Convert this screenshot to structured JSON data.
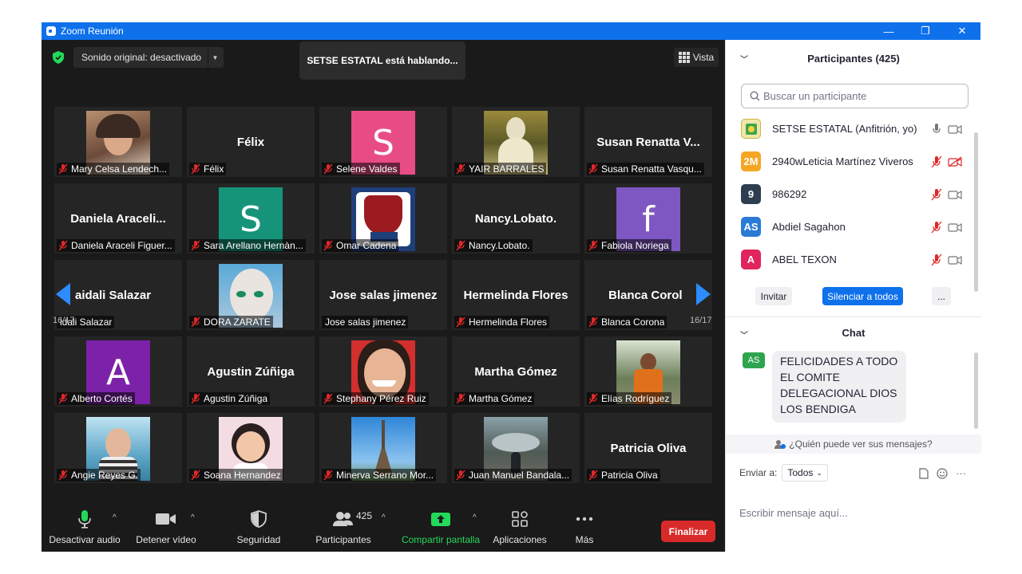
{
  "window": {
    "title": "Zoom Reunión",
    "minimize": "—",
    "restore": "❐",
    "close": "✕"
  },
  "meeting": {
    "audio_dropdown": "Sonido original: desactivado",
    "speaking_banner": "SETSE ESTATAL está hablando...",
    "view_button": "Vista",
    "page_indicator": "16/17"
  },
  "tiles": [
    {
      "name": "Mary Celsa  Lendech...",
      "type": "photo"
    },
    {
      "name": "Félix",
      "big": "Félix",
      "type": "text"
    },
    {
      "name": "Selene Valdes",
      "letter": "S",
      "color": "#e84c85",
      "type": "letter"
    },
    {
      "name": "YAIR BARRALES",
      "type": "photo"
    },
    {
      "name": "Susan Renatta Vasqu...",
      "big": "Susan Renatta V...",
      "type": "text"
    },
    {
      "name": "Daniela Araceli Figuer...",
      "big": "Daniela  Araceli...",
      "type": "text"
    },
    {
      "name": "Sara Arellano Hernàn...",
      "letter": "S",
      "color": "#16947a",
      "type": "letter"
    },
    {
      "name": "Omar Cadena",
      "type": "photo"
    },
    {
      "name": "Nancy.Lobato.",
      "big": "Nancy.Lobato.",
      "type": "text"
    },
    {
      "name": "Fabiola Noriega",
      "letter": "f",
      "color": "#7e57c2",
      "type": "letter"
    },
    {
      "name": "idali Salazar",
      "big": "aidali Salazar",
      "type": "text"
    },
    {
      "name": "DORA ZARATE",
      "type": "photo"
    },
    {
      "name": "Jose salas jimenez",
      "big": "Jose salas jimenez",
      "type": "text"
    },
    {
      "name": "Hermelinda Flores",
      "big": "Hermelinda Flores",
      "type": "text"
    },
    {
      "name": "Blanca Corona",
      "big": "Blanca Corol",
      "type": "text"
    },
    {
      "name": "Alberto Cortés",
      "letter": "A",
      "color": "#7b22a8",
      "type": "letter"
    },
    {
      "name": "Agustin Zúñiga",
      "big": "Agustin Zúñiga",
      "type": "text"
    },
    {
      "name": "Stephany Pérez Ruiz",
      "type": "photo"
    },
    {
      "name": "Martha Gómez",
      "big": "Martha Gómez",
      "type": "text"
    },
    {
      "name": "Elías Rodríguez",
      "type": "photo"
    },
    {
      "name": "Angie Reyes G.",
      "type": "photo"
    },
    {
      "name": "Soana Hernandez",
      "type": "photo"
    },
    {
      "name": "Minerva Serrano Mor...",
      "type": "photo"
    },
    {
      "name": "Juan Manuel Bandala...",
      "type": "photo"
    },
    {
      "name": "Patricia Oliva",
      "big": "Patricia Oliva",
      "type": "text"
    }
  ],
  "toolbar": {
    "audio": "Desactivar audio",
    "video": "Detener vídeo",
    "security": "Seguridad",
    "participants": "Participantes",
    "participants_count": "425",
    "share": "Compartir pantalla",
    "apps": "Aplicaciones",
    "more": "Más",
    "end": "Finalizar"
  },
  "panel": {
    "participants_title": "Participantes (425)",
    "search_placeholder": "Buscar un participante",
    "participants": [
      {
        "initials": "",
        "name": "SETSE ESTATAL (Anfitrión, yo)",
        "color": "#d9c04a"
      },
      {
        "initials": "2M",
        "name": "2940wLeticia Martínez Viveros",
        "color": "#f5a623"
      },
      {
        "initials": "9",
        "name": "986292",
        "color": "#2d3e50"
      },
      {
        "initials": "AS",
        "name": "Abdiel Sagahon",
        "color": "#2a7bd6"
      },
      {
        "initials": "A",
        "name": "ABEL TEXON",
        "color": "#e0245e"
      }
    ],
    "invite": "Invitar",
    "mute_all": "Silenciar a todos",
    "more": "...",
    "chat_title": "Chat",
    "chat_avatar": "AS",
    "chat_message": "FELICIDADES A TODO EL COMITE DELEGACIONAL DIOS LOS BENDIGA",
    "who_sees": "¿Quién puede ver sus mensajes?",
    "send_to_label": "Enviar a:",
    "send_to_value": "Todos",
    "input_placeholder": "Escribir mensaje aquí..."
  }
}
